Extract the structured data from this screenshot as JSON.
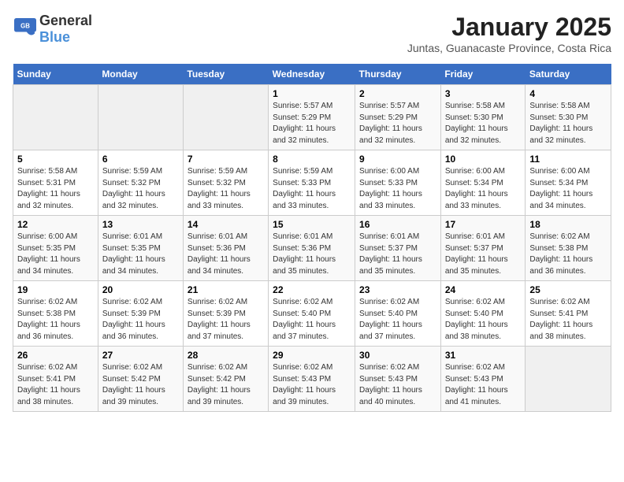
{
  "header": {
    "logo_general": "General",
    "logo_blue": "Blue",
    "title": "January 2025",
    "subtitle": "Juntas, Guanacaste Province, Costa Rica"
  },
  "calendar": {
    "days_of_week": [
      "Sunday",
      "Monday",
      "Tuesday",
      "Wednesday",
      "Thursday",
      "Friday",
      "Saturday"
    ],
    "weeks": [
      [
        {
          "day": "",
          "sunrise": "",
          "sunset": "",
          "daylight": ""
        },
        {
          "day": "",
          "sunrise": "",
          "sunset": "",
          "daylight": ""
        },
        {
          "day": "",
          "sunrise": "",
          "sunset": "",
          "daylight": ""
        },
        {
          "day": "1",
          "sunrise": "Sunrise: 5:57 AM",
          "sunset": "Sunset: 5:29 PM",
          "daylight": "Daylight: 11 hours and 32 minutes."
        },
        {
          "day": "2",
          "sunrise": "Sunrise: 5:57 AM",
          "sunset": "Sunset: 5:29 PM",
          "daylight": "Daylight: 11 hours and 32 minutes."
        },
        {
          "day": "3",
          "sunrise": "Sunrise: 5:58 AM",
          "sunset": "Sunset: 5:30 PM",
          "daylight": "Daylight: 11 hours and 32 minutes."
        },
        {
          "day": "4",
          "sunrise": "Sunrise: 5:58 AM",
          "sunset": "Sunset: 5:30 PM",
          "daylight": "Daylight: 11 hours and 32 minutes."
        }
      ],
      [
        {
          "day": "5",
          "sunrise": "Sunrise: 5:58 AM",
          "sunset": "Sunset: 5:31 PM",
          "daylight": "Daylight: 11 hours and 32 minutes."
        },
        {
          "day": "6",
          "sunrise": "Sunrise: 5:59 AM",
          "sunset": "Sunset: 5:32 PM",
          "daylight": "Daylight: 11 hours and 32 minutes."
        },
        {
          "day": "7",
          "sunrise": "Sunrise: 5:59 AM",
          "sunset": "Sunset: 5:32 PM",
          "daylight": "Daylight: 11 hours and 33 minutes."
        },
        {
          "day": "8",
          "sunrise": "Sunrise: 5:59 AM",
          "sunset": "Sunset: 5:33 PM",
          "daylight": "Daylight: 11 hours and 33 minutes."
        },
        {
          "day": "9",
          "sunrise": "Sunrise: 6:00 AM",
          "sunset": "Sunset: 5:33 PM",
          "daylight": "Daylight: 11 hours and 33 minutes."
        },
        {
          "day": "10",
          "sunrise": "Sunrise: 6:00 AM",
          "sunset": "Sunset: 5:34 PM",
          "daylight": "Daylight: 11 hours and 33 minutes."
        },
        {
          "day": "11",
          "sunrise": "Sunrise: 6:00 AM",
          "sunset": "Sunset: 5:34 PM",
          "daylight": "Daylight: 11 hours and 34 minutes."
        }
      ],
      [
        {
          "day": "12",
          "sunrise": "Sunrise: 6:00 AM",
          "sunset": "Sunset: 5:35 PM",
          "daylight": "Daylight: 11 hours and 34 minutes."
        },
        {
          "day": "13",
          "sunrise": "Sunrise: 6:01 AM",
          "sunset": "Sunset: 5:35 PM",
          "daylight": "Daylight: 11 hours and 34 minutes."
        },
        {
          "day": "14",
          "sunrise": "Sunrise: 6:01 AM",
          "sunset": "Sunset: 5:36 PM",
          "daylight": "Daylight: 11 hours and 34 minutes."
        },
        {
          "day": "15",
          "sunrise": "Sunrise: 6:01 AM",
          "sunset": "Sunset: 5:36 PM",
          "daylight": "Daylight: 11 hours and 35 minutes."
        },
        {
          "day": "16",
          "sunrise": "Sunrise: 6:01 AM",
          "sunset": "Sunset: 5:37 PM",
          "daylight": "Daylight: 11 hours and 35 minutes."
        },
        {
          "day": "17",
          "sunrise": "Sunrise: 6:01 AM",
          "sunset": "Sunset: 5:37 PM",
          "daylight": "Daylight: 11 hours and 35 minutes."
        },
        {
          "day": "18",
          "sunrise": "Sunrise: 6:02 AM",
          "sunset": "Sunset: 5:38 PM",
          "daylight": "Daylight: 11 hours and 36 minutes."
        }
      ],
      [
        {
          "day": "19",
          "sunrise": "Sunrise: 6:02 AM",
          "sunset": "Sunset: 5:38 PM",
          "daylight": "Daylight: 11 hours and 36 minutes."
        },
        {
          "day": "20",
          "sunrise": "Sunrise: 6:02 AM",
          "sunset": "Sunset: 5:39 PM",
          "daylight": "Daylight: 11 hours and 36 minutes."
        },
        {
          "day": "21",
          "sunrise": "Sunrise: 6:02 AM",
          "sunset": "Sunset: 5:39 PM",
          "daylight": "Daylight: 11 hours and 37 minutes."
        },
        {
          "day": "22",
          "sunrise": "Sunrise: 6:02 AM",
          "sunset": "Sunset: 5:40 PM",
          "daylight": "Daylight: 11 hours and 37 minutes."
        },
        {
          "day": "23",
          "sunrise": "Sunrise: 6:02 AM",
          "sunset": "Sunset: 5:40 PM",
          "daylight": "Daylight: 11 hours and 37 minutes."
        },
        {
          "day": "24",
          "sunrise": "Sunrise: 6:02 AM",
          "sunset": "Sunset: 5:40 PM",
          "daylight": "Daylight: 11 hours and 38 minutes."
        },
        {
          "day": "25",
          "sunrise": "Sunrise: 6:02 AM",
          "sunset": "Sunset: 5:41 PM",
          "daylight": "Daylight: 11 hours and 38 minutes."
        }
      ],
      [
        {
          "day": "26",
          "sunrise": "Sunrise: 6:02 AM",
          "sunset": "Sunset: 5:41 PM",
          "daylight": "Daylight: 11 hours and 38 minutes."
        },
        {
          "day": "27",
          "sunrise": "Sunrise: 6:02 AM",
          "sunset": "Sunset: 5:42 PM",
          "daylight": "Daylight: 11 hours and 39 minutes."
        },
        {
          "day": "28",
          "sunrise": "Sunrise: 6:02 AM",
          "sunset": "Sunset: 5:42 PM",
          "daylight": "Daylight: 11 hours and 39 minutes."
        },
        {
          "day": "29",
          "sunrise": "Sunrise: 6:02 AM",
          "sunset": "Sunset: 5:43 PM",
          "daylight": "Daylight: 11 hours and 39 minutes."
        },
        {
          "day": "30",
          "sunrise": "Sunrise: 6:02 AM",
          "sunset": "Sunset: 5:43 PM",
          "daylight": "Daylight: 11 hours and 40 minutes."
        },
        {
          "day": "31",
          "sunrise": "Sunrise: 6:02 AM",
          "sunset": "Sunset: 5:43 PM",
          "daylight": "Daylight: 11 hours and 41 minutes."
        },
        {
          "day": "",
          "sunrise": "",
          "sunset": "",
          "daylight": ""
        }
      ]
    ]
  }
}
